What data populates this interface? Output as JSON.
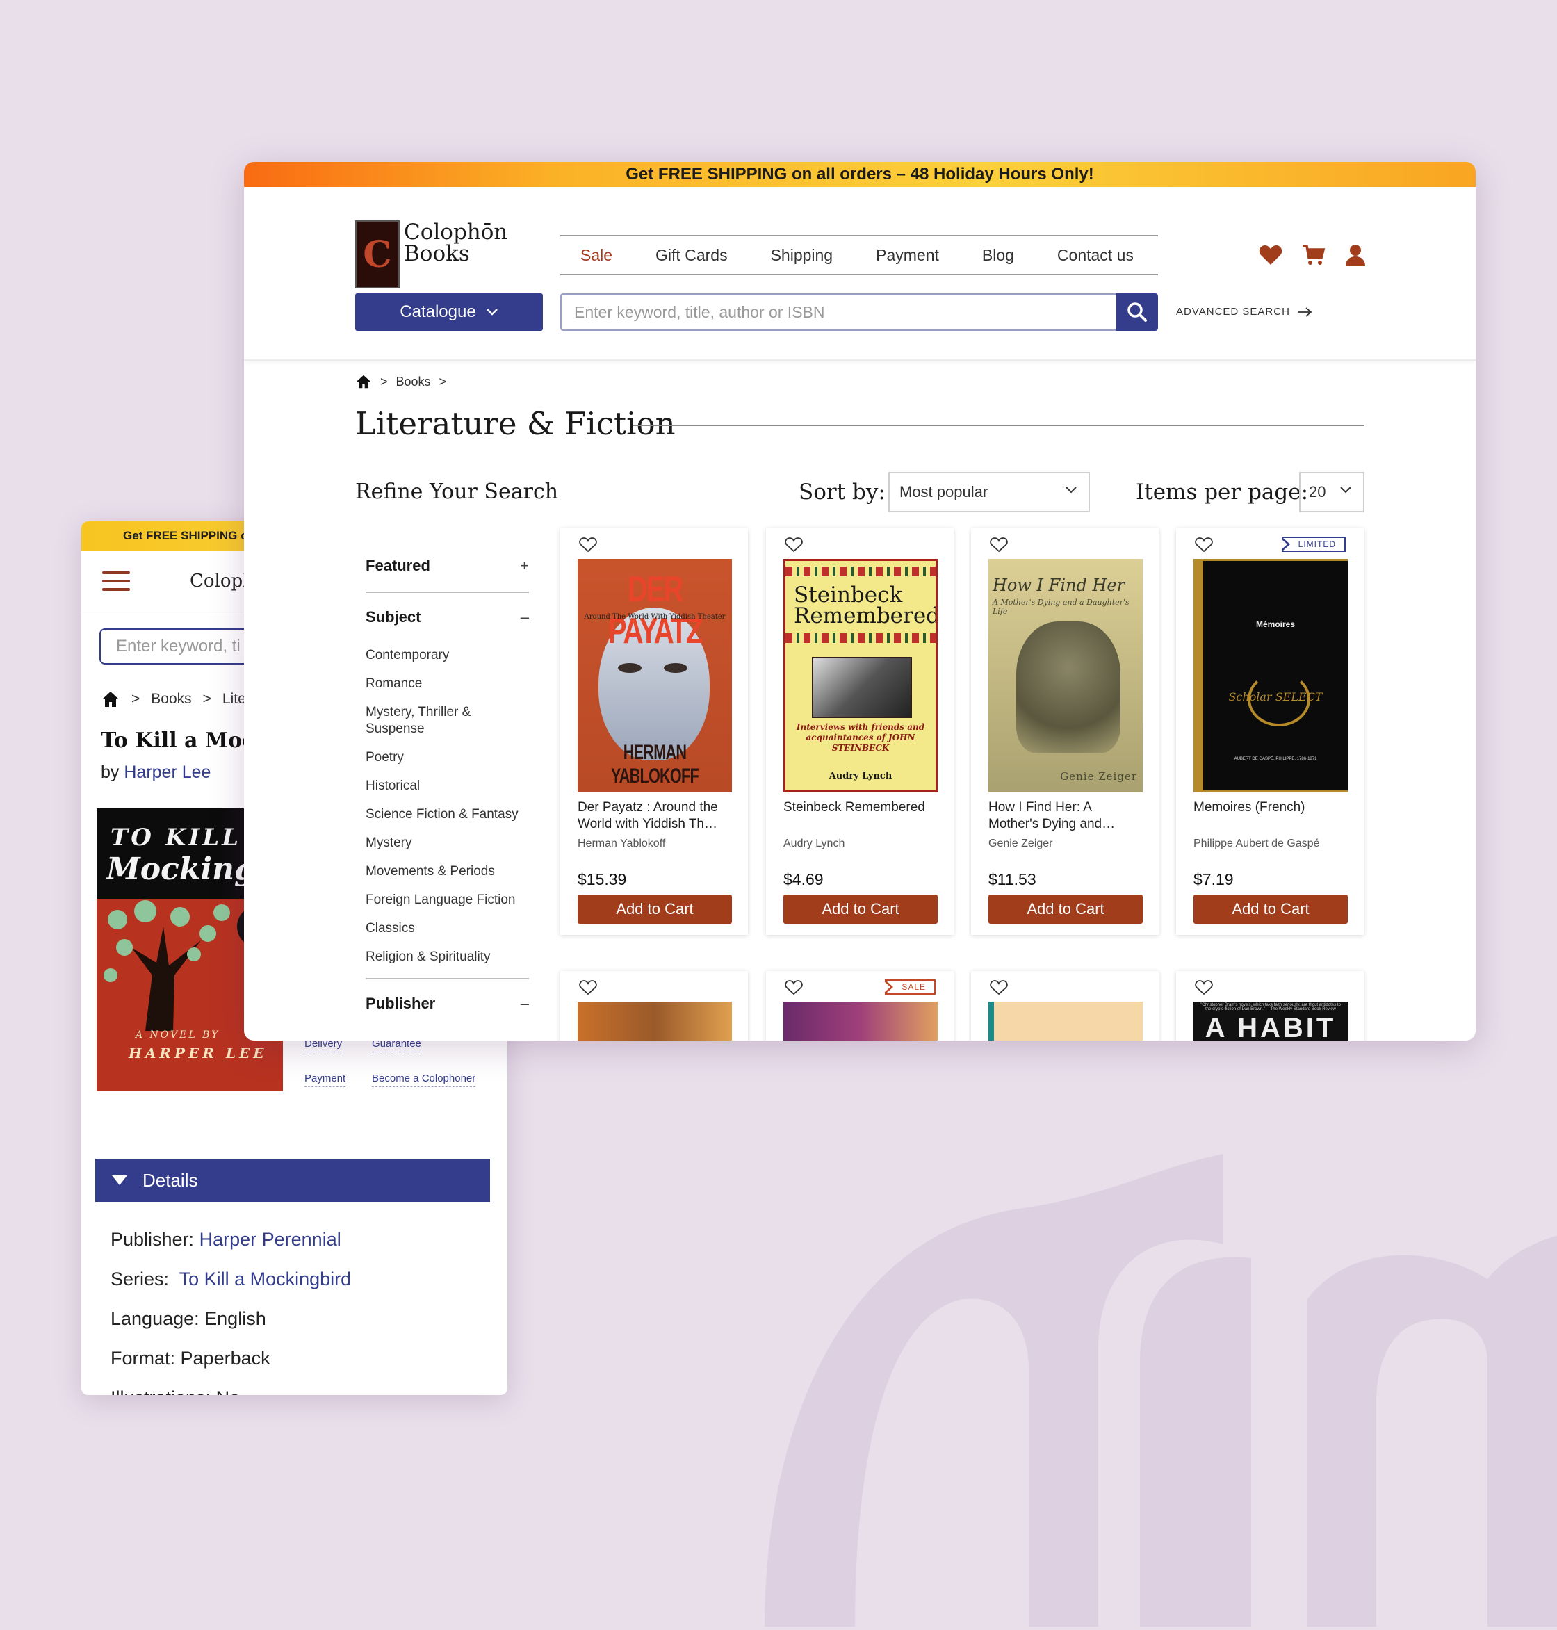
{
  "colors": {
    "accent": "#343d8c",
    "brand": "#a13d1b",
    "background": "#e9dfeb",
    "banner": "#fbc12a"
  },
  "mobile": {
    "banner": "Get FREE SHIPPING o",
    "logo": "Colophō",
    "search_placeholder": "Enter keyword, ti",
    "breadcrumb": [
      "Books",
      "Liter"
    ],
    "title": "To Kill a Mock",
    "by_label": "by",
    "author": "Harper Lee",
    "cover": {
      "line1": "TO KILL A",
      "line2": "Mockingbi",
      "novel_by": "A NOVEL BY",
      "author": "HARPER LEE"
    },
    "links": [
      "Delivery",
      "Guarantee",
      "Payment",
      "Become a Colophoner"
    ],
    "details_label": "Details",
    "details": [
      {
        "label": "Publisher:",
        "value": "Harper Perennial"
      },
      {
        "label": "Series:",
        "value": "To Kill a Mockingbird"
      },
      {
        "label": "Language:",
        "value": "English"
      },
      {
        "label": "Format:",
        "value": "Paperback"
      },
      {
        "label": "Illustrations:",
        "value": "No"
      }
    ]
  },
  "desktop": {
    "banner": "Get FREE SHIPPING on all orders – 48 Holiday Hours Only!",
    "logo": {
      "badge": "C",
      "line1": "Colophōn",
      "line2": "Books"
    },
    "nav": [
      "Sale",
      "Gift Cards",
      "Shipping",
      "Payment",
      "Blog",
      "Contact us"
    ],
    "icons": [
      "heart-icon",
      "cart-icon",
      "user-icon"
    ],
    "catalogue_label": "Catalogue",
    "search_placeholder": "Enter keyword, title, author or ISBN",
    "advanced_search": "ADVANCED SEARCH",
    "breadcrumb": [
      "Books"
    ],
    "page_title": "Literature & Fiction",
    "refine_title": "Refine Your Search",
    "sort_label": "Sort by:",
    "sort_value": "Most popular",
    "ipp_label": "Items per page:",
    "ipp_value": "20",
    "filters": {
      "featured": {
        "label": "Featured",
        "toggle": "+"
      },
      "subject": {
        "label": "Subject",
        "toggle": "–",
        "items": [
          "Contemporary",
          "Romance",
          "Mystery, Thriller & Suspense",
          "Poetry",
          "Historical",
          "Science Fiction & Fantasy",
          "Mystery",
          "Movements & Periods",
          "Foreign Language Fiction",
          "Classics",
          "Religion & Spirituality"
        ]
      },
      "publisher": {
        "label": "Publisher",
        "toggle": "–"
      }
    },
    "products": [
      {
        "title": "Der Payatz : Around the World with Yiddish Th…",
        "author": "Herman Yablokoff",
        "price": "$15.39",
        "button": "Add to Cart",
        "cover": {
          "title": "DER PAYATZ",
          "subtitle": "Around The World With Yiddish Theater",
          "author": "HERMAN YABLOKOFF"
        }
      },
      {
        "title": "Steinbeck Remembered",
        "author": "Audry Lynch",
        "price": "$4.69",
        "button": "Add to Cart",
        "cover": {
          "title": "Steinbeck Remembered",
          "subtitle": "Interviews with friends and acquaintances of JOHN STEINBECK",
          "author": "Audry Lynch"
        }
      },
      {
        "title": "How I Find Her: A Mother's Dying and…",
        "author": "Genie Zeiger",
        "price": "$11.53",
        "button": "Add to Cart",
        "cover": {
          "title": "How I Find Her",
          "subtitle": "A Mother's Dying and a Daughter's Life",
          "author": "Genie Zeiger"
        }
      },
      {
        "title": "Memoires (French)",
        "author": "Philippe Aubert de Gaspé",
        "price": "$7.19",
        "button": "Add to Cart",
        "badge": "LIMITED",
        "cover": {
          "title": "Mémoires",
          "series": "Scholar SELECT",
          "author": "AUBERT DE GASPÉ, PHILIPPE, 1786-1871"
        }
      }
    ],
    "row2_badge": "SALE",
    "row2_cover_text": "A HABIT",
    "row2_quote": "\"Christopher Bram's novels, which take faith seriously, are thout antidotes to the crypto-fiction of Dan Brown.\" —The Weekly Standard Book Review"
  }
}
